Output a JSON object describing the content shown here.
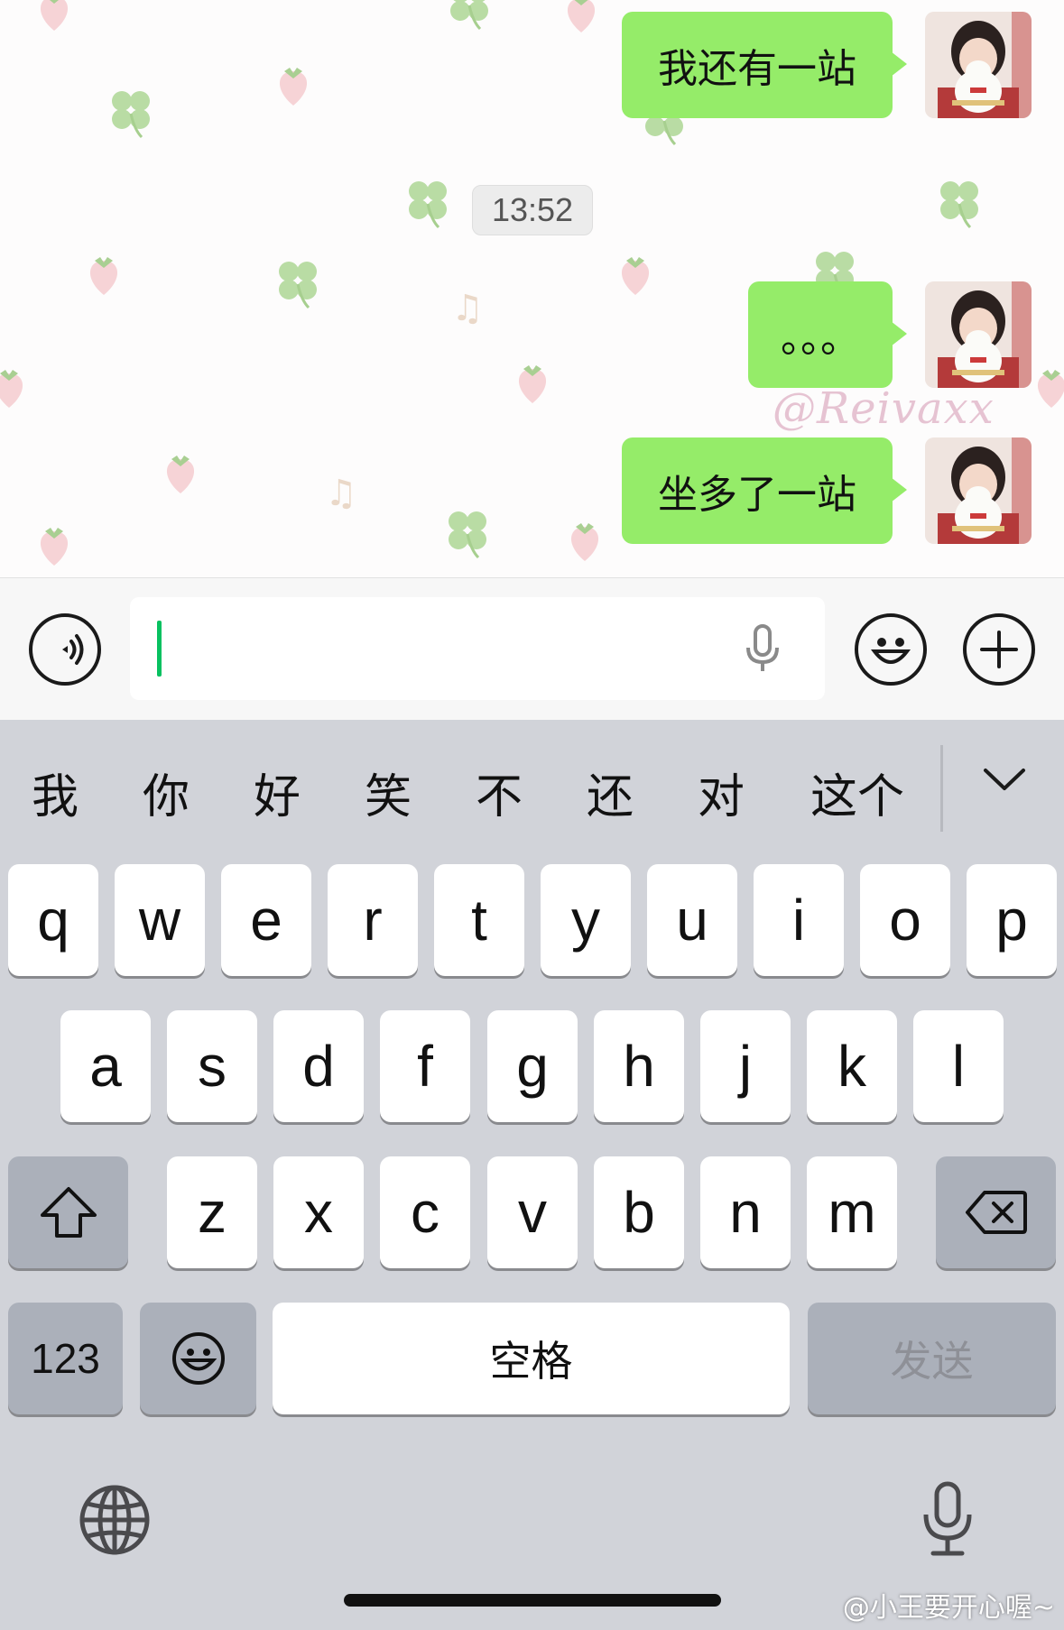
{
  "chat": {
    "messages": [
      {
        "text": "我还有一站",
        "from": "me"
      },
      {
        "text": "。。。",
        "from": "me"
      },
      {
        "text": "坐多了一站",
        "from": "me"
      }
    ],
    "timestamp": "13:52",
    "watermark": "@Reivaxx",
    "bubble_color": "#95ec69"
  },
  "input_bar": {
    "voice_toggle_icon": "voice-wave-icon",
    "mic_icon": "microphone-icon",
    "emoji_icon": "emoji-icon",
    "plus_icon": "plus-icon",
    "caret_color": "#07c160"
  },
  "keyboard": {
    "candidates": [
      "我",
      "你",
      "好",
      "笑",
      "不",
      "还",
      "对",
      "这个"
    ],
    "collapse_icon": "chevron-down-icon",
    "row1": [
      "q",
      "w",
      "e",
      "r",
      "t",
      "y",
      "u",
      "i",
      "o",
      "p"
    ],
    "row2": [
      "a",
      "s",
      "d",
      "f",
      "g",
      "h",
      "j",
      "k",
      "l"
    ],
    "row3": [
      "z",
      "x",
      "c",
      "v",
      "b",
      "n",
      "m"
    ],
    "shift_icon": "shift-arrow-icon",
    "delete_icon": "backspace-icon",
    "numbers_label": "123",
    "emoji_key_icon": "emoji-icon",
    "space_label": "空格",
    "send_label": "发送",
    "globe_icon": "globe-icon",
    "dictation_icon": "microphone-icon"
  },
  "footer": {
    "weibo_watermark": "@小王要开心喔~"
  }
}
